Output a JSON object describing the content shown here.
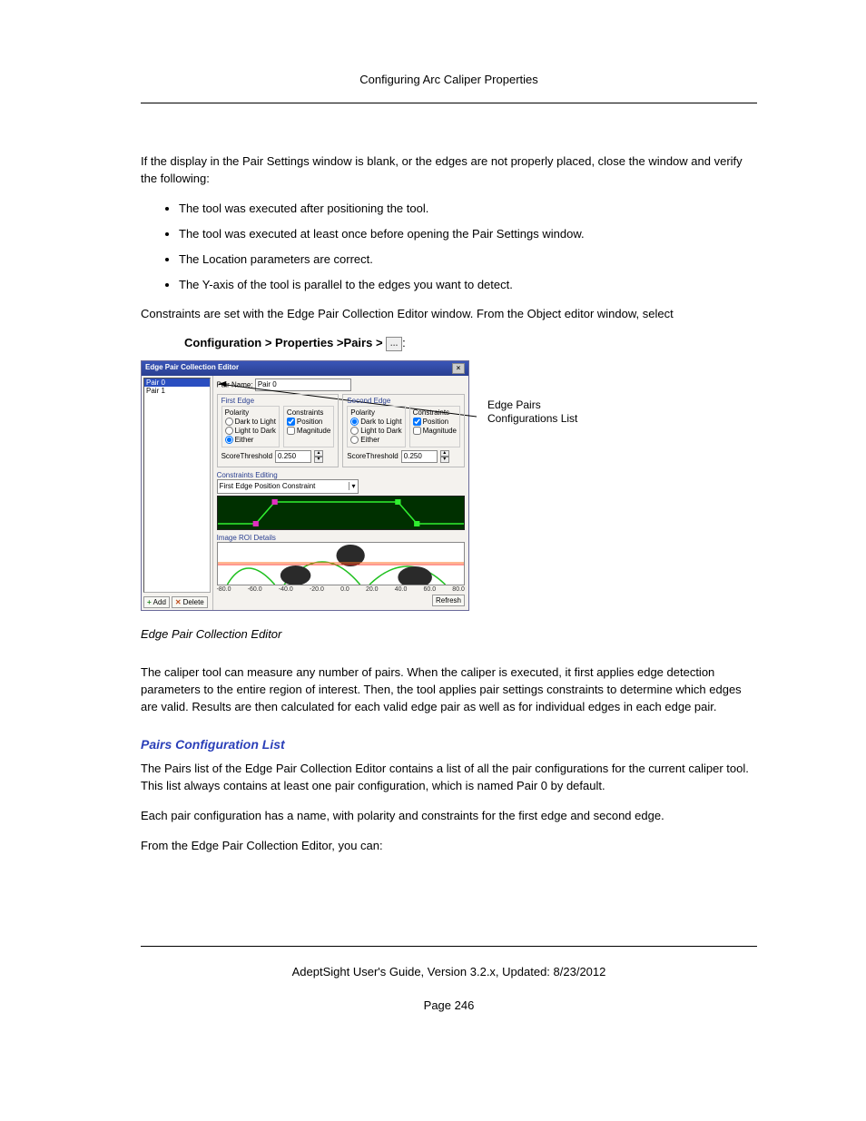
{
  "header": {
    "title": "Configuring Arc Caliper Properties"
  },
  "p1": "If the display in the Pair Settings window is blank, or the edges are not properly placed, close the window and verify the following:",
  "bullets": [
    "The tool was executed after positioning the tool.",
    "The tool was executed at least once before opening the Pair Settings window.",
    "The Location parameters are correct.",
    "The Y-axis of the tool is parallel to the edges you want to detect."
  ],
  "p2": "Constraints are set with the Edge Pair Collection Editor window. From the Object editor window, select",
  "nav_path": "Configuration > Properties >Pairs > ",
  "nav_suffix": ":",
  "callout": "Edge Pairs Configurations List",
  "caption": "Edge Pair Collection Editor",
  "p3": "The caliper tool can measure any number of pairs. When the caliper is executed, it first applies edge detection parameters to the entire region of interest. Then, the tool applies pair settings constraints to determine which edges are valid. Results are then calculated for each valid edge pair as well as for individual edges in each edge pair.",
  "sub_h": "Pairs Configuration List",
  "p4": "The Pairs list of the Edge Pair Collection Editor contains a list of all the pair configurations for the current caliper tool. This list always contains at least one pair configuration, which is named Pair 0 by default.",
  "p5": "Each pair configuration has a name, with polarity and constraints for the first edge and second edge.",
  "p6": "From the Edge Pair Collection Editor, you can:",
  "footer": {
    "guide": "AdeptSight User's Guide,  Version 3.2.x, Updated: 8/23/2012",
    "page": "Page 246"
  },
  "editor": {
    "title": "Edge Pair Collection Editor",
    "list": {
      "items": [
        "Pair 0",
        "Pair 1"
      ],
      "selected_index": 0
    },
    "add_label": "Add",
    "delete_label": "Delete",
    "pairname_label": "Pair Name:",
    "pairname_value": "Pair 0",
    "first_edge": {
      "title": "First Edge",
      "polarity_label": "Polarity",
      "opts": [
        "Dark to Light",
        "Light to Dark",
        "Either"
      ],
      "selected": 2,
      "constraints_label": "Constraints",
      "position": "Position",
      "magnitude": "Magnitude",
      "pos_checked": true,
      "mag_checked": false,
      "score_label": "ScoreThreshold",
      "score_value": "0.250"
    },
    "second_edge": {
      "title": "Second Edge",
      "polarity_label": "Polarity",
      "opts": [
        "Dark to Light",
        "Light to Dark",
        "Either"
      ],
      "selected": 0,
      "constraints_label": "Constraints",
      "position": "Position",
      "magnitude": "Magnitude",
      "pos_checked": true,
      "mag_checked": false,
      "score_label": "ScoreThreshold",
      "score_value": "0.250"
    },
    "ce_label": "Constraints Editing",
    "ce_select": "First Edge Position Constraint",
    "roi_label": "Image ROI Details",
    "axis_ticks": [
      "-80.0",
      "-60.0",
      "-40.0",
      "-20.0",
      "0.0",
      "20.0",
      "40.0",
      "60.0",
      "80.0"
    ],
    "refresh": "Refresh"
  }
}
